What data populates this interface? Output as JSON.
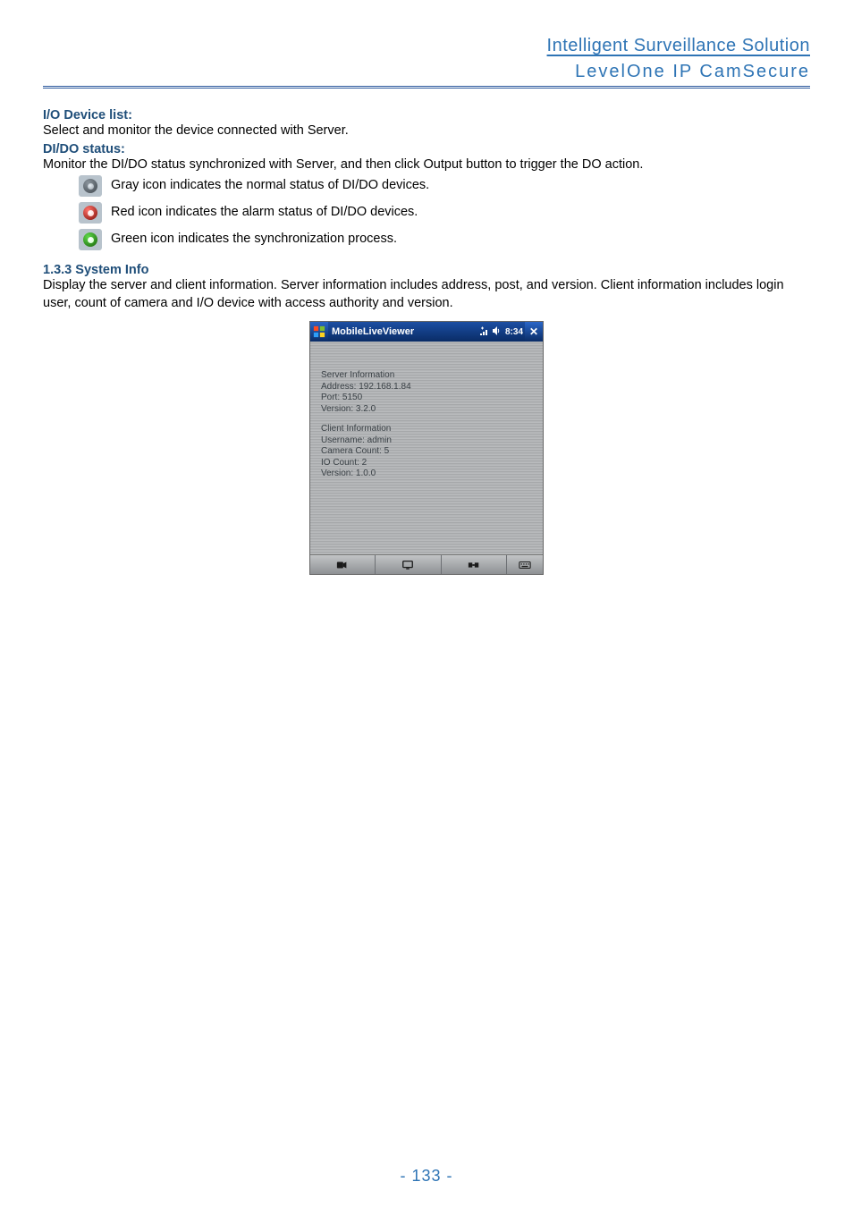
{
  "header": {
    "top": "Intelligent Surveillance Solution",
    "sub": "LevelOne IP CamSecure"
  },
  "sections": {
    "io_device_list": {
      "title": "I/O Device list:",
      "text": "Select and monitor the device connected with Server."
    },
    "dido_status": {
      "title": "DI/DO status:",
      "text": "Monitor the DI/DO status synchronized with Server, and then click Output button to trigger the DO action.",
      "icons": {
        "gray": "Gray icon indicates the normal status of DI/DO devices.",
        "red": "Red icon indicates the alarm status of DI/DO devices.",
        "green": "Green icon indicates the synchronization process."
      }
    },
    "system_info": {
      "title": "1.3.3 System Info",
      "text": "Display the server and client information. Server information includes address, post, and version. Client information includes login user, count of camera and I/O device with access authority and version."
    }
  },
  "screenshot": {
    "title": "MobileLiveViewer",
    "clock": "8:34",
    "server_info": {
      "heading": "Server Information",
      "address": "Address: 192.168.1.84",
      "port": "Port: 5150",
      "version": "Version: 3.2.0"
    },
    "client_info": {
      "heading": "Client Information",
      "username": "Username: admin",
      "camera_count": "Camera Count: 5",
      "io_count": "IO Count: 2",
      "version": "Version: 1.0.0"
    }
  },
  "page_number": "- 133 -"
}
